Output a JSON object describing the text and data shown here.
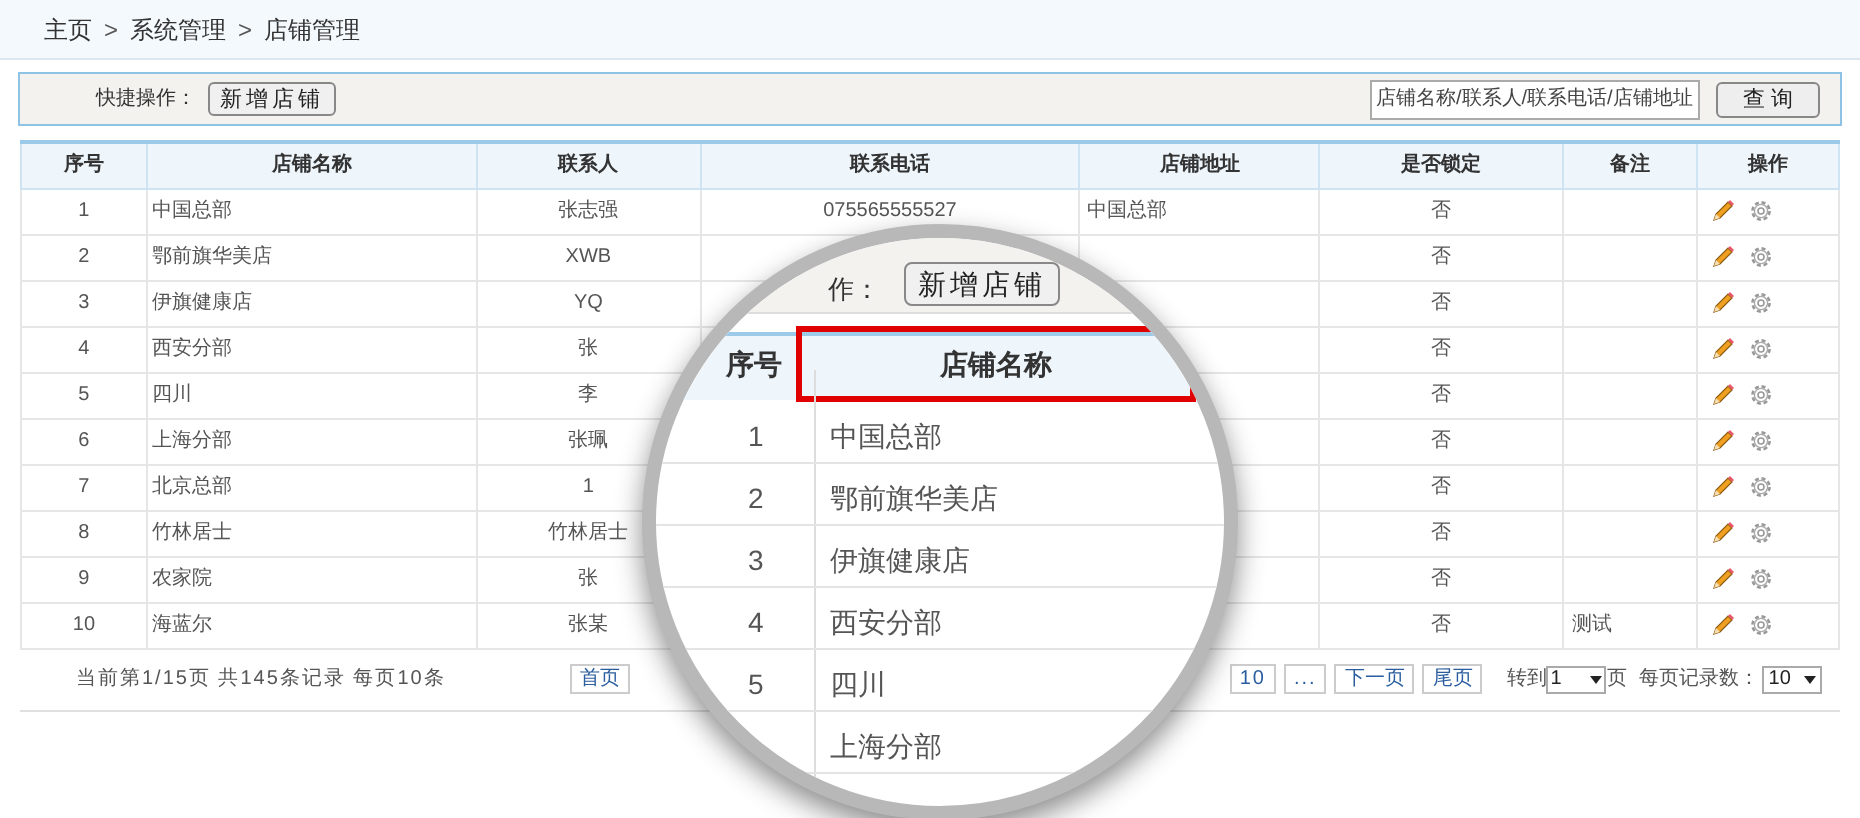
{
  "breadcrumb": [
    {
      "kind": "link",
      "text": "主页"
    },
    {
      "kind": "separator",
      "text": ">"
    },
    {
      "kind": "link",
      "text": "系统管理"
    },
    {
      "kind": "separator",
      "text": ">"
    },
    {
      "kind": "current",
      "text": "店铺管理"
    }
  ],
  "toolbar": {
    "label": "快捷操作：",
    "add_button": "新增店铺",
    "search": {
      "placeholder": "店铺名称/联系人/联系电话/店铺地址"
    },
    "search_button": "查 询"
  },
  "table": {
    "columns": [
      "序号",
      "店铺名称",
      "联系人",
      "联系电话",
      "店铺地址",
      "是否锁定",
      "备注",
      "操作"
    ],
    "rows": [
      {
        "index": "1",
        "name": "中国总部",
        "contact": "张志强",
        "phone": "075565555527",
        "address": "中国总部",
        "locked": "否"
      },
      {
        "index": "2",
        "name": "鄂前旗华美店",
        "contact": "XWB",
        "locked": "否"
      },
      {
        "index": "3",
        "name": "伊旗健康店",
        "contact": "YQ",
        "locked": "否"
      },
      {
        "index": "4",
        "name": "西安分部",
        "contact": "张",
        "locked": "否"
      },
      {
        "index": "5",
        "name": "四川",
        "contact": "李",
        "locked": "否"
      },
      {
        "index": "6",
        "name": "上海分部",
        "contact": "张珮",
        "locked": "否"
      },
      {
        "index": "7",
        "name": "北京总部",
        "contact": "1",
        "locked": "否"
      },
      {
        "index": "8",
        "name": "竹林居士",
        "contact": "竹林居士",
        "locked": "否"
      },
      {
        "index": "9",
        "name": "农家院",
        "contact": "张",
        "locked": "否"
      },
      {
        "index": "10",
        "name": "海蓝尔",
        "contact": "张某",
        "locked": "否",
        "remark": "测试"
      }
    ]
  },
  "pagination": {
    "summary": "当前第1/15页 共145条记录 每页10条",
    "first": "首页",
    "pages": [
      "10",
      "..."
    ],
    "next": "下一页",
    "last": "尾页",
    "goto_label": "转到",
    "goto_value": "1",
    "page_unit": "页",
    "per_page_label": "每页记录数：",
    "per_page_value": "10"
  },
  "magnifier": {
    "toolbar_label": "作：",
    "add_button": "新增店铺",
    "columns": [
      {
        "label": "序号",
        "highlighted": false
      },
      {
        "label": "店铺名称",
        "highlighted": true
      }
    ],
    "rows": [
      {
        "index": "1",
        "name": "中国总部"
      },
      {
        "index": "2",
        "name": "鄂前旗华美店"
      },
      {
        "index": "3",
        "name": "伊旗健康店"
      },
      {
        "index": "4",
        "name": "西安分部"
      },
      {
        "index": "5",
        "name": "四川"
      },
      {
        "name": "上海分部"
      }
    ]
  }
}
